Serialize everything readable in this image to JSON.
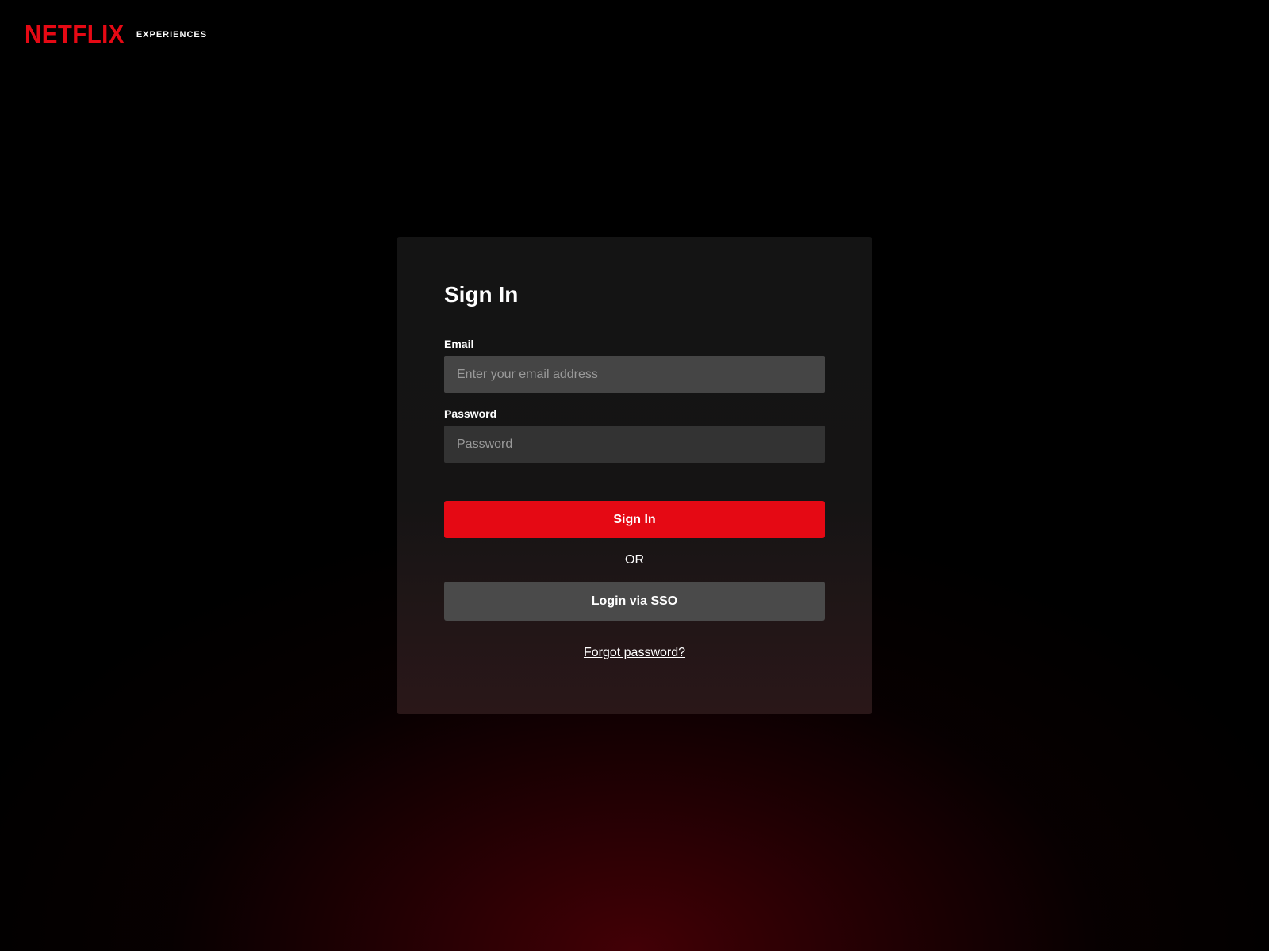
{
  "header": {
    "logo_text": "NETFLIX",
    "subtitle": "EXPERIENCES"
  },
  "signin": {
    "title": "Sign In",
    "email_label": "Email",
    "email_placeholder": "Enter your email address",
    "email_value": "",
    "password_label": "Password",
    "password_placeholder": "Password",
    "password_value": "",
    "submit_label": "Sign In",
    "or_text": "OR",
    "sso_label": "Login via SSO",
    "forgot_label": "Forgot password?"
  },
  "colors": {
    "brand_red": "#e50914",
    "page_background": "#000000",
    "card_background": "#141414",
    "email_field_background": "#454545",
    "password_field_background": "#333333",
    "sso_button_background": "#4a4a4a",
    "glow": "#3a0005"
  }
}
